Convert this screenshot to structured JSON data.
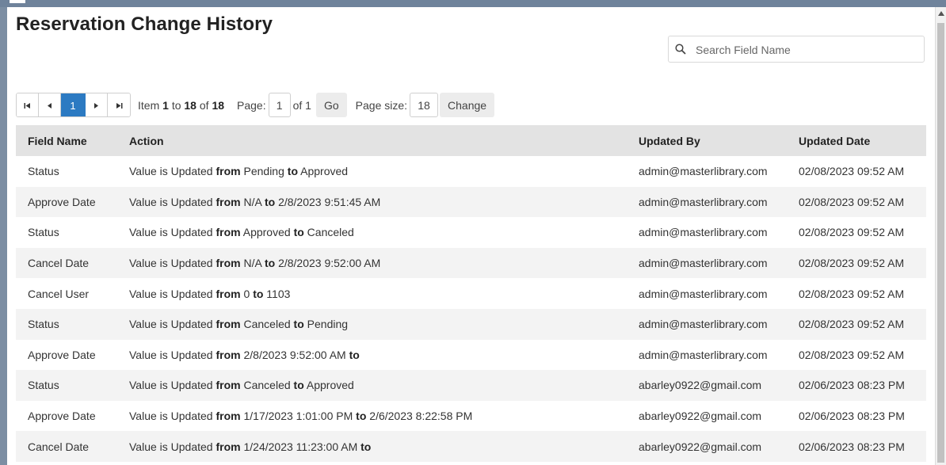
{
  "page": {
    "title": "Reservation Change History"
  },
  "search": {
    "placeholder": "Search Field Name"
  },
  "pager": {
    "current_page_label": "1",
    "item_label": "Item",
    "item_from": "1",
    "to_label": "to",
    "item_to": "18",
    "of_label": "of",
    "item_total": "18",
    "page_label": "Page:",
    "page_value": "1",
    "of_pages": "of 1",
    "go_label": "Go",
    "page_size_label": "Page size:",
    "page_size_value": "18",
    "change_label": "Change"
  },
  "table": {
    "headers": [
      "Field Name",
      "Action",
      "Updated By",
      "Updated Date"
    ],
    "action_prefix": "Value is Updated",
    "from_word": "from",
    "to_word": "to",
    "rows": [
      {
        "field": "Status",
        "from_val": "Pending",
        "to_val": "Approved",
        "by": "admin@masterlibrary.com",
        "date": "02/08/2023 09:52 AM"
      },
      {
        "field": "Approve Date",
        "from_val": "N/A",
        "to_val": "2/8/2023 9:51:45 AM",
        "by": "admin@masterlibrary.com",
        "date": "02/08/2023 09:52 AM"
      },
      {
        "field": "Status",
        "from_val": "Approved",
        "to_val": "Canceled",
        "by": "admin@masterlibrary.com",
        "date": "02/08/2023 09:52 AM"
      },
      {
        "field": "Cancel Date",
        "from_val": "N/A",
        "to_val": "2/8/2023 9:52:00 AM",
        "by": "admin@masterlibrary.com",
        "date": "02/08/2023 09:52 AM"
      },
      {
        "field": "Cancel User",
        "from_val": "0",
        "to_val": "1103",
        "by": "admin@masterlibrary.com",
        "date": "02/08/2023 09:52 AM"
      },
      {
        "field": "Status",
        "from_val": "Canceled",
        "to_val": "Pending",
        "by": "admin@masterlibrary.com",
        "date": "02/08/2023 09:52 AM"
      },
      {
        "field": "Approve Date",
        "from_val": "2/8/2023 9:52:00 AM",
        "to_val": "",
        "by": "admin@masterlibrary.com",
        "date": "02/08/2023 09:52 AM"
      },
      {
        "field": "Status",
        "from_val": "Canceled",
        "to_val": "Approved",
        "by": "abarley0922@gmail.com",
        "date": "02/06/2023 08:23 PM"
      },
      {
        "field": "Approve Date",
        "from_val": "1/17/2023 1:01:00 PM",
        "to_val": "2/6/2023 8:22:58 PM",
        "by": "abarley0922@gmail.com",
        "date": "02/06/2023 08:23 PM"
      },
      {
        "field": "Cancel Date",
        "from_val": "1/24/2023 11:23:00 AM",
        "to_val": "",
        "by": "abarley0922@gmail.com",
        "date": "02/06/2023 08:23 PM"
      }
    ]
  },
  "icons": {
    "search": "search-icon",
    "first": "first-page-icon",
    "prev": "prev-page-icon",
    "next": "next-page-icon",
    "last": "last-page-icon"
  },
  "colors": {
    "accent": "#2c7ac2",
    "header_bg": "#e3e3e3",
    "stripe": "#f3f3f3",
    "frame": "#7c8ea3"
  }
}
